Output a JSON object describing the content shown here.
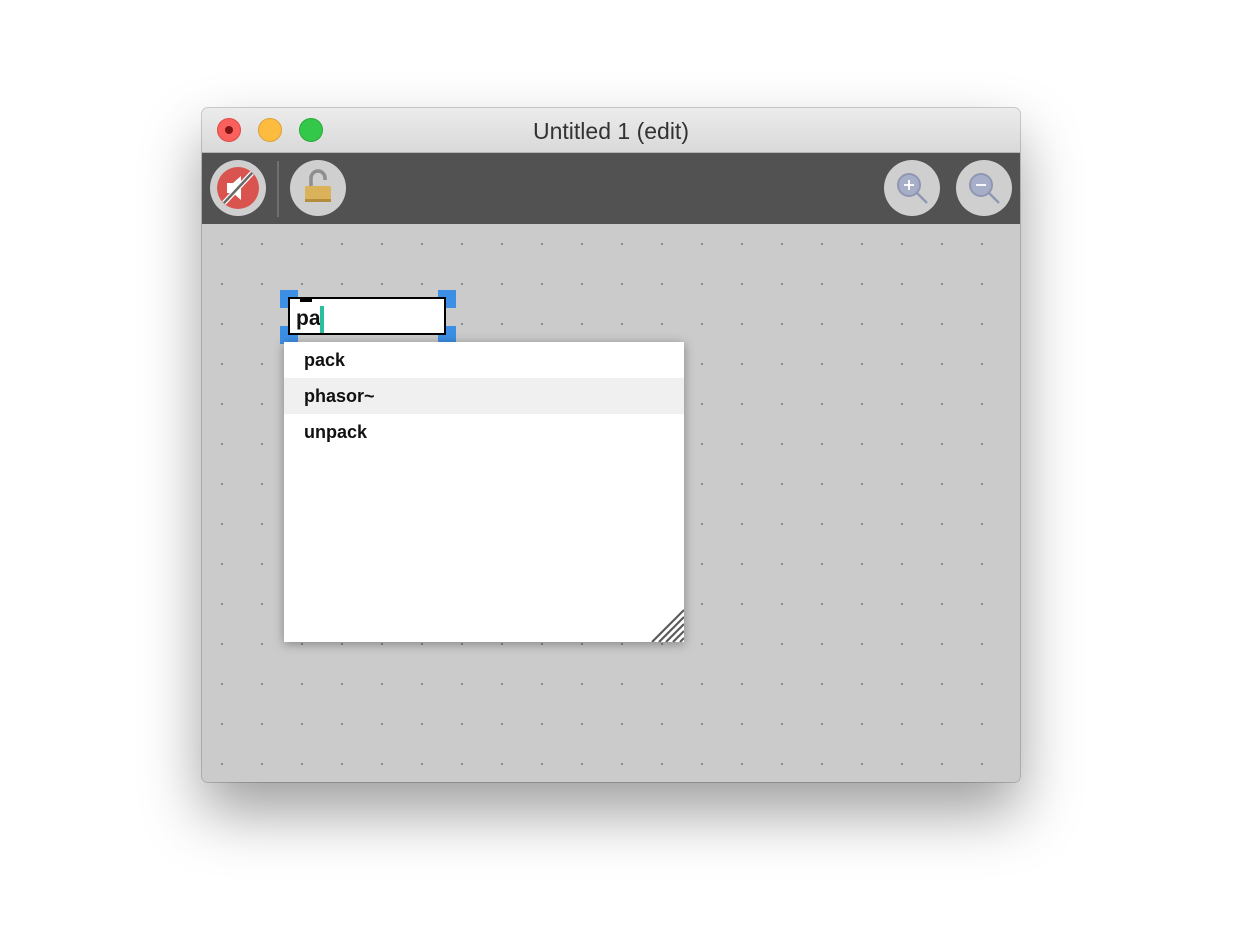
{
  "window": {
    "title": "Untitled 1 (edit)",
    "controls": [
      "close",
      "minimize",
      "zoom"
    ]
  },
  "toolbar": {
    "buttons": [
      {
        "name": "mute",
        "icon": "speaker-muted-icon"
      },
      {
        "name": "lock",
        "icon": "unlocked-padlock-icon"
      },
      {
        "name": "zoom-in",
        "icon": "zoom-in-icon"
      },
      {
        "name": "zoom-out",
        "icon": "zoom-out-icon"
      }
    ]
  },
  "editor": {
    "object_text": "pa"
  },
  "autocomplete": {
    "items": [
      "pack",
      "phasor~",
      "unpack"
    ],
    "highlighted_index": 1
  },
  "colors": {
    "selection": "#3d8fe5",
    "caret": "#2bbf9e",
    "toolbar": "#525252",
    "canvas": "#cbcbcb",
    "mute_red": "#d9534f"
  }
}
